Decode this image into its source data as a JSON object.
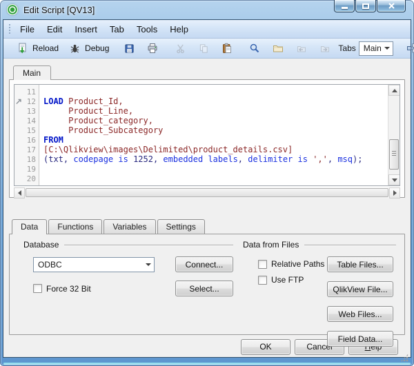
{
  "titlebar": {
    "title": "Edit Script [QV13]"
  },
  "menu": {
    "items": [
      "File",
      "Edit",
      "Insert",
      "Tab",
      "Tools",
      "Help"
    ]
  },
  "toolbar": {
    "reload": "Reload",
    "debug": "Debug",
    "tabs_label": "Tabs",
    "tab_selector_value": "Main",
    "icons": [
      "reload",
      "debug",
      "save",
      "print",
      "cut",
      "copy",
      "paste",
      "find",
      "open",
      "back",
      "forward",
      "move-tab",
      "syntax-check"
    ]
  },
  "script_editor": {
    "active_tab": "Main",
    "lines": [
      {
        "num": "11",
        "tokens": []
      },
      {
        "num": "12",
        "marker": true,
        "tokens": [
          [
            "kw",
            "LOAD"
          ],
          [
            "pl",
            " "
          ],
          [
            "id",
            "Product_Id,"
          ]
        ]
      },
      {
        "num": "13",
        "tokens": [
          [
            "pl",
            "     "
          ],
          [
            "id",
            "Product_Line,"
          ]
        ]
      },
      {
        "num": "14",
        "tokens": [
          [
            "pl",
            "     "
          ],
          [
            "id",
            "Product_category,"
          ]
        ]
      },
      {
        "num": "15",
        "tokens": [
          [
            "pl",
            "     "
          ],
          [
            "id",
            "Product_Subcategory"
          ]
        ]
      },
      {
        "num": "16",
        "tokens": [
          [
            "kw",
            "FROM"
          ]
        ]
      },
      {
        "num": "17",
        "tokens": [
          [
            "id",
            "[C:\\Qlikview\\images\\Delimited\\product_details.csv]"
          ]
        ]
      },
      {
        "num": "18",
        "tokens": [
          [
            "pn",
            "(txt, "
          ],
          [
            "fn",
            "codepage is"
          ],
          [
            "pn",
            " 1252, "
          ],
          [
            "fn",
            "embedded labels"
          ],
          [
            "pn",
            ", "
          ],
          [
            "fn",
            "delimiter is"
          ],
          [
            "pn",
            " "
          ],
          [
            "id",
            "','"
          ],
          [
            "pn",
            ", "
          ],
          [
            "fn",
            "msq"
          ],
          [
            "pn",
            ");"
          ]
        ]
      },
      {
        "num": "19",
        "tokens": []
      },
      {
        "num": "20",
        "tokens": []
      }
    ]
  },
  "bottom_tabs": [
    {
      "label": "Data",
      "active": true
    },
    {
      "label": "Functions",
      "active": false
    },
    {
      "label": "Variables",
      "active": false
    },
    {
      "label": "Settings",
      "active": false
    }
  ],
  "database_group": {
    "title": "Database",
    "select_value": "ODBC",
    "connect_button": "Connect...",
    "select_button": "Select...",
    "force32_label": "Force 32 Bit",
    "force32_checked": false
  },
  "files_group": {
    "title": "Data from Files",
    "checkboxes": [
      {
        "label": "Relative Paths",
        "checked": false
      },
      {
        "label": "Use FTP",
        "checked": false
      }
    ],
    "buttons": [
      "Table Files...",
      "QlikView File...",
      "Web Files...",
      "Field Data..."
    ]
  },
  "footer": {
    "ok": "OK",
    "cancel": "Cancel",
    "help_accel": "H",
    "help_rest": "elp"
  },
  "colors": {
    "keyword_blue": "#0014C8",
    "identifier_maroon": "#8B2727",
    "titlebar_blue": "#679FD4",
    "toolbar_blue": "#D5E5F7",
    "dialog_gray": "#F0F0F0"
  }
}
